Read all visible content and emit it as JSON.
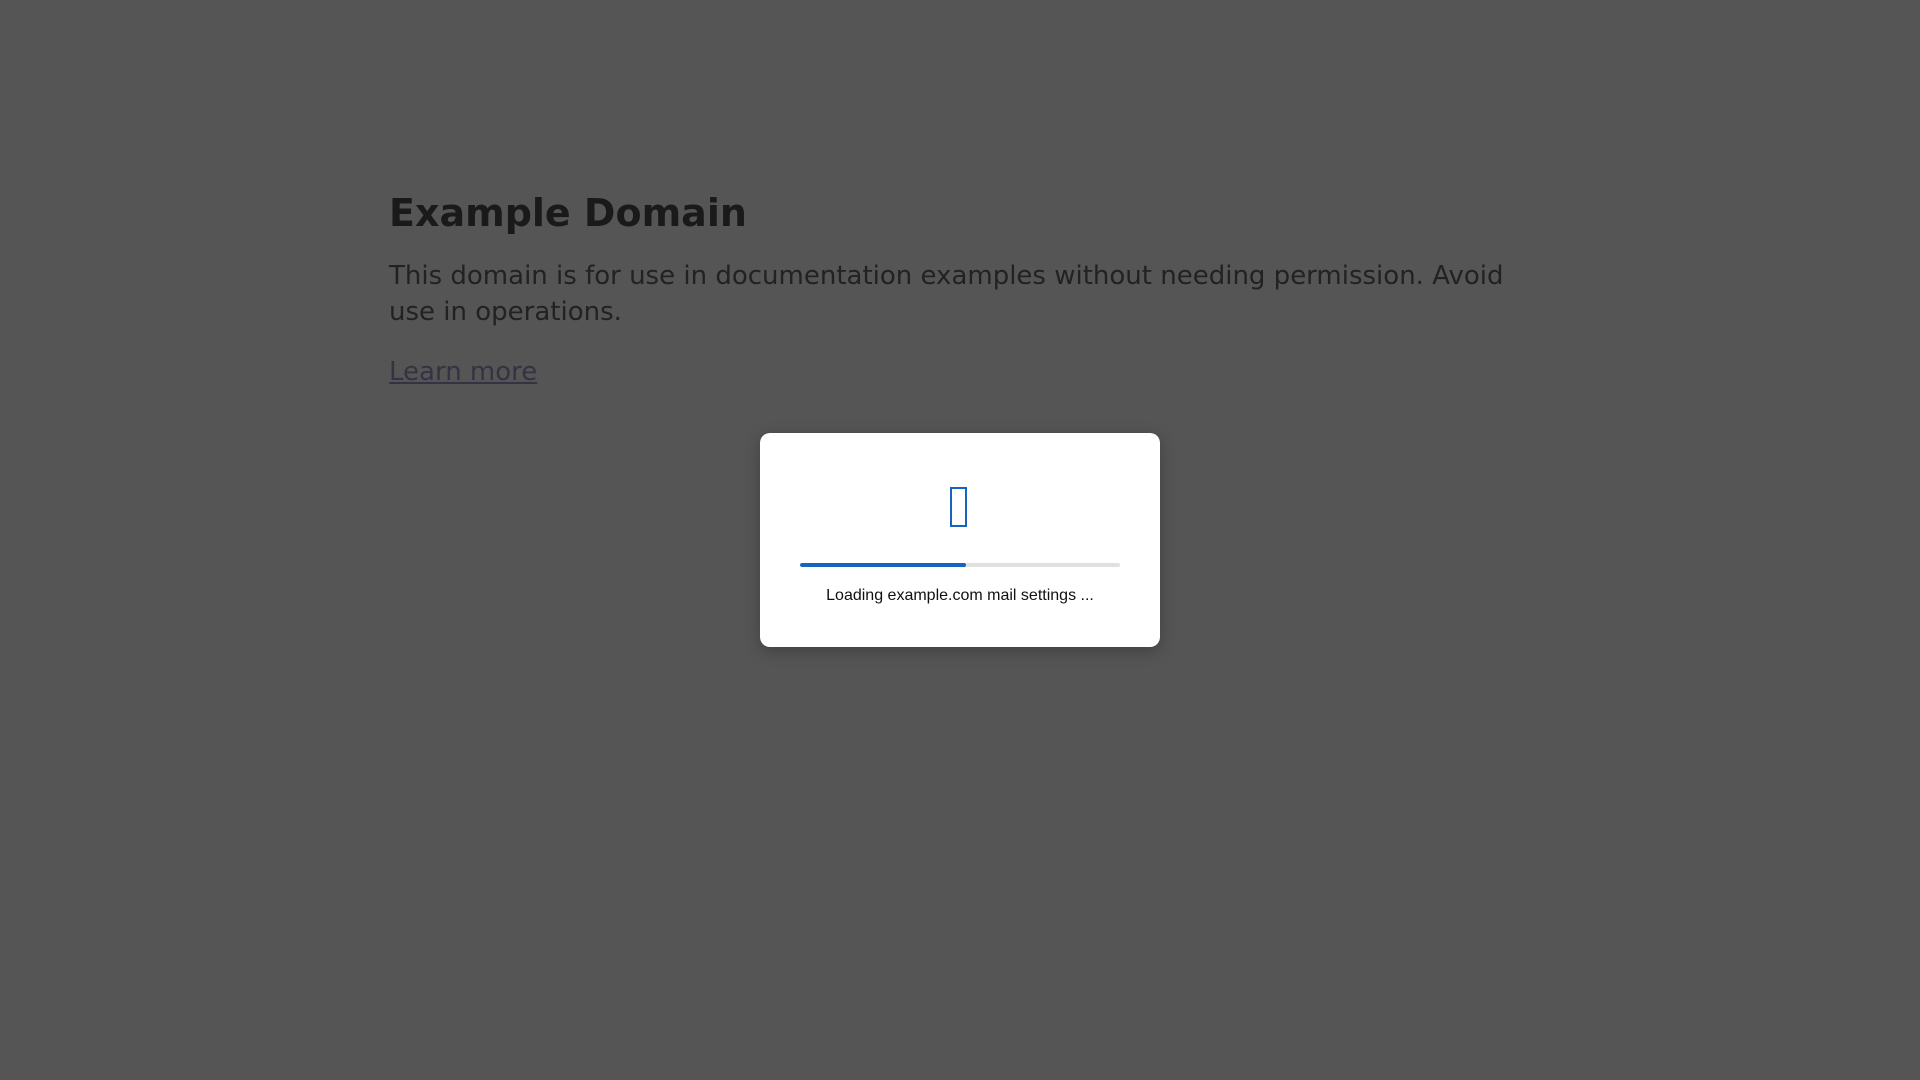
{
  "page": {
    "title": "Example Domain",
    "description": "This domain is for use in documentation examples without needing permission. Avoid use in operations.",
    "link_text": "Learn more"
  },
  "modal": {
    "icon": "loading-glyph-icon",
    "progress_fraction": 0.52,
    "message": "Loading example.com mail settings ..."
  },
  "colors": {
    "overlay_background": "#555555",
    "modal_background": "#ffffff",
    "accent": "#1565c0",
    "progress_track": "#e0e0e0"
  }
}
